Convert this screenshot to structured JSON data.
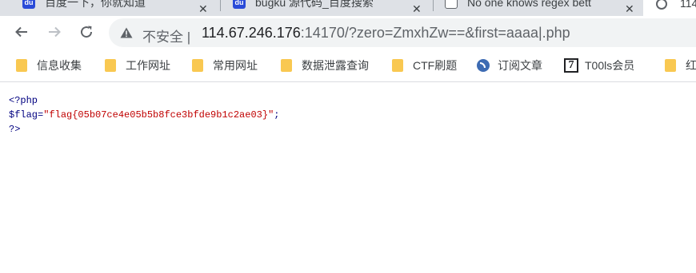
{
  "tabs": [
    {
      "favicon": "baidu-icon",
      "title": "百度一下，你就知道",
      "close": "✕"
    },
    {
      "favicon": "baidu-icon",
      "title": "bugku 源代码_百度搜索",
      "close": "✕"
    },
    {
      "favicon": "globe-icon",
      "title": "No one knows regex bett",
      "close": "✕"
    },
    {
      "favicon": "globe-icon",
      "title": "114",
      "active": true
    }
  ],
  "toolbar": {
    "back": "back-icon",
    "forward": "forward-icon",
    "reload": "reload-icon",
    "security_label": "不安全 |",
    "url_host": "114.67.246.176",
    "url_rest": ":14170/?zero=ZmxhZw==&first=aaaa|.php"
  },
  "bookmarks": [
    {
      "icon": "folder-icon",
      "label": "信息收集"
    },
    {
      "icon": "folder-icon",
      "label": "工作网址"
    },
    {
      "icon": "folder-icon",
      "label": "常用网址"
    },
    {
      "icon": "folder-icon",
      "label": "数据泄露查询"
    },
    {
      "icon": "folder-icon",
      "label": "CTF刷题"
    },
    {
      "icon": "rss-icon",
      "label": "订阅文章"
    },
    {
      "icon": "t00ls-icon",
      "label": "T00ls会员"
    },
    {
      "icon": "folder-icon",
      "label": "红"
    }
  ],
  "page": {
    "open_tag": "<?php",
    "var": "$flag=",
    "value": "\"flag{05b07ce4e05b5b8fce3bfde9b1c2ae03}\"",
    "semicolon": ";",
    "close_tag": "?>"
  },
  "colors": {
    "tabstrip": "#dee1e6",
    "omnibox": "#f1f3f4",
    "folder": "#f9c851",
    "code": "#000080",
    "string": "#c00000"
  }
}
